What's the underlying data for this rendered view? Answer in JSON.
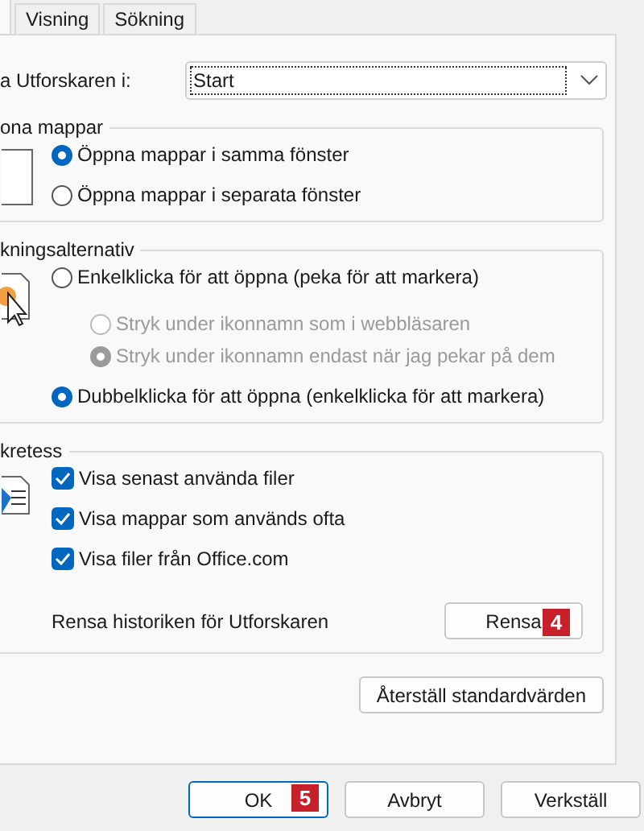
{
  "tabs": [
    {
      "label": "Visning",
      "selected": false
    },
    {
      "label": "Sökning",
      "selected": false
    }
  ],
  "open_in": {
    "label": "a Utforskaren i:",
    "value": "Start"
  },
  "groups": [
    {
      "title": "ona mappar",
      "options": [
        {
          "kind": "radio",
          "label": "Öppna mappar i samma fönster",
          "selected": true,
          "disabled": false
        },
        {
          "kind": "radio",
          "label": "Öppna mappar i separata fönster",
          "selected": false,
          "disabled": false
        }
      ]
    },
    {
      "title": "kningsalternativ",
      "options": [
        {
          "kind": "radio",
          "label": "Enkelklicka för att öppna (peka för att markera)",
          "selected": false,
          "disabled": false,
          "children": [
            {
              "kind": "radio",
              "label": "Stryk under ikonnamn som i webbläsaren",
              "selected": false,
              "disabled": true
            },
            {
              "kind": "radio",
              "label": "Stryk under ikonnamn endast när jag pekar på dem",
              "selected": true,
              "disabled": true
            }
          ]
        },
        {
          "kind": "radio",
          "label": "Dubbelklicka för att öppna (enkelklicka för att markera)",
          "selected": true,
          "disabled": false
        }
      ]
    },
    {
      "title": "kretess",
      "options": [
        {
          "kind": "checkbox",
          "label": "Visa senast använda filer",
          "checked": true
        },
        {
          "kind": "checkbox",
          "label": "Visa mappar som används ofta",
          "checked": true
        },
        {
          "kind": "checkbox",
          "label": "Visa filer från Office.com",
          "checked": true
        }
      ],
      "clear": {
        "label": "Rensa historiken för Utforskaren",
        "button": "Rensa",
        "badge": "4"
      }
    }
  ],
  "restore_button": "Återställ standardvärden",
  "footer_buttons": [
    {
      "label": "OK",
      "default": true,
      "badge": "5"
    },
    {
      "label": "Avbryt",
      "default": false
    },
    {
      "label": "Verkställ",
      "default": false
    }
  ]
}
